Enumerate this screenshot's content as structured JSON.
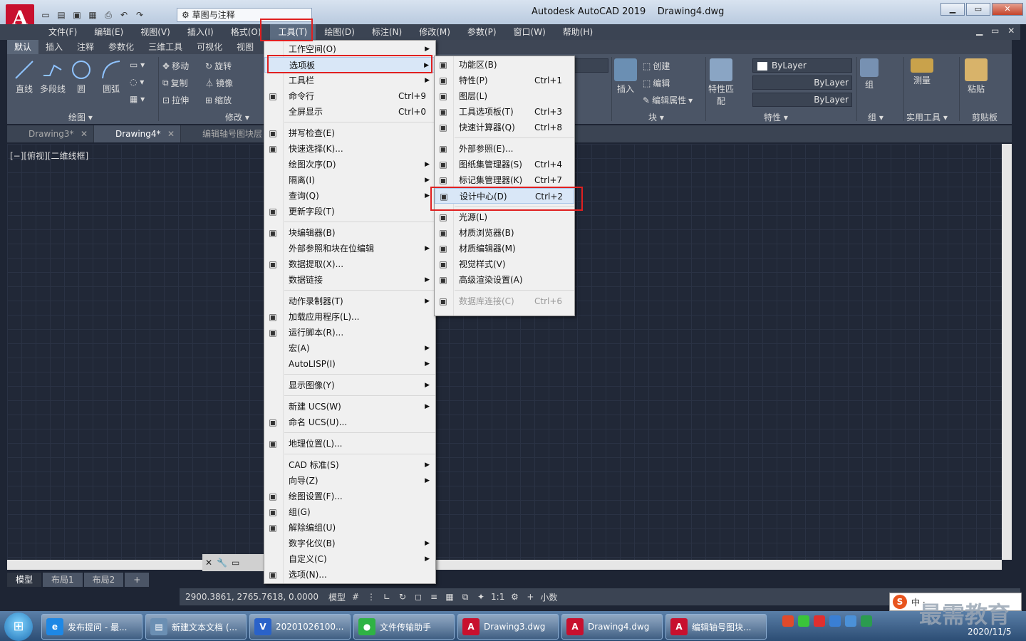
{
  "app": {
    "title": "Autodesk AutoCAD 2019",
    "filename": "Drawing4.dwg",
    "logo_letter": "A",
    "workspace": "草图与注释",
    "win_min": "▁",
    "win_restore": "▭",
    "win_close": "✕"
  },
  "menubar": [
    "文件(F)",
    "编辑(E)",
    "视图(V)",
    "插入(I)",
    "格式(O)",
    "工具(T)",
    "绘图(D)",
    "标注(N)",
    "修改(M)",
    "参数(P)",
    "窗口(W)",
    "帮助(H)"
  ],
  "menubar_active": 5,
  "ribbon_tabs": [
    "默认",
    "插入",
    "注释",
    "参数化",
    "三维工具",
    "可视化",
    "视图"
  ],
  "ribbon": {
    "draw_tools": [
      "直线",
      "多段线",
      "圆",
      "圆弧"
    ],
    "draw_panel": "绘图 ▾",
    "modify_tools": [
      "移动",
      "旋转",
      "复制",
      "镜像",
      "拉伸",
      "缩放"
    ],
    "modify_panel": "修改 ▾",
    "block_insert": "插入",
    "block_tools": [
      "创建",
      "编辑",
      "编辑属性"
    ],
    "block_panel": "块 ▾",
    "match_props": "特性匹配",
    "bylayer": [
      "ByLayer",
      "ByLayer",
      "ByLayer"
    ],
    "props_panel": "特性 ▾",
    "group": "组",
    "group_panel": "组 ▾",
    "measure": "测量",
    "utils_panel": "实用工具 ▾",
    "paste": "粘贴",
    "clipboard_panel": "剪贴板"
  },
  "doc_tabs": [
    "Drawing3*",
    "Drawing4*",
    "编辑轴号图块层"
  ],
  "view_label": "[−][俯视][二维线框]",
  "layout_tabs": [
    "模型",
    "布局1",
    "布局2",
    "+"
  ],
  "status": {
    "coords": "2900.3861, 2765.7618, 0.0000",
    "model": "模型",
    "scale": "1:1",
    "units": "小数"
  },
  "tools_menu": [
    {
      "label": "工作空间(O)",
      "arrow": true
    },
    {
      "label": "选项板",
      "arrow": true,
      "highlight": true
    },
    {
      "label": "工具栏",
      "arrow": true
    },
    {
      "label": "命令行",
      "shortcut": "Ctrl+9",
      "icon": "command-line-icon"
    },
    {
      "label": "全屏显示",
      "shortcut": "Ctrl+0"
    },
    {
      "sep": true
    },
    {
      "label": "拼写检查(E)",
      "icon": "spell-check-icon"
    },
    {
      "label": "快速选择(K)...",
      "icon": "quick-select-icon"
    },
    {
      "label": "绘图次序(D)",
      "arrow": true
    },
    {
      "label": "隔离(I)",
      "arrow": true
    },
    {
      "label": "查询(Q)",
      "arrow": true
    },
    {
      "label": "更新字段(T)",
      "icon": "update-field-icon"
    },
    {
      "sep": true
    },
    {
      "label": "块编辑器(B)",
      "icon": "block-editor-icon"
    },
    {
      "label": "外部参照和块在位编辑",
      "arrow": true
    },
    {
      "label": "数据提取(X)...",
      "icon": "data-extract-icon"
    },
    {
      "label": "数据链接",
      "arrow": true
    },
    {
      "sep": true
    },
    {
      "label": "动作录制器(T)",
      "arrow": true
    },
    {
      "label": "加载应用程序(L)...",
      "icon": "load-app-icon"
    },
    {
      "label": "运行脚本(R)...",
      "icon": "run-script-icon"
    },
    {
      "label": "宏(A)",
      "arrow": true
    },
    {
      "label": "AutoLISP(I)",
      "arrow": true
    },
    {
      "sep": true
    },
    {
      "label": "显示图像(Y)",
      "arrow": true
    },
    {
      "sep": true
    },
    {
      "label": "新建 UCS(W)",
      "arrow": true
    },
    {
      "label": "命名 UCS(U)...",
      "icon": "named-ucs-icon"
    },
    {
      "sep": true
    },
    {
      "label": "地理位置(L)...",
      "icon": "globe-icon"
    },
    {
      "sep": true
    },
    {
      "label": "CAD 标准(S)",
      "arrow": true
    },
    {
      "label": "向导(Z)",
      "arrow": true
    },
    {
      "label": "绘图设置(F)...",
      "icon": "drafting-settings-icon"
    },
    {
      "label": "组(G)",
      "icon": "group-icon"
    },
    {
      "label": "解除编组(U)",
      "icon": "ungroup-icon"
    },
    {
      "label": "数字化仪(B)",
      "arrow": true
    },
    {
      "label": "自定义(C)",
      "arrow": true
    },
    {
      "label": "选项(N)...",
      "icon": "options-check-icon"
    }
  ],
  "palettes_menu": [
    {
      "label": "功能区(B)",
      "icon": "ribbon-icon"
    },
    {
      "label": "特性(P)",
      "shortcut": "Ctrl+1",
      "icon": "properties-icon"
    },
    {
      "label": "图层(L)",
      "icon": "layers-icon"
    },
    {
      "label": "工具选项板(T)",
      "shortcut": "Ctrl+3",
      "icon": "tool-palettes-icon"
    },
    {
      "label": "快速计算器(Q)",
      "shortcut": "Ctrl+8",
      "icon": "calculator-icon"
    },
    {
      "sep": true
    },
    {
      "label": "外部参照(E)...",
      "icon": "xref-icon"
    },
    {
      "label": "图纸集管理器(S)",
      "shortcut": "Ctrl+4",
      "icon": "sheet-set-icon"
    },
    {
      "label": "标记集管理器(K)",
      "shortcut": "Ctrl+7",
      "icon": "markup-set-icon"
    },
    {
      "label": "设计中心(D)",
      "shortcut": "Ctrl+2",
      "icon": "design-center-icon",
      "highlight": true
    },
    {
      "sep": true
    },
    {
      "label": "光源(L)",
      "icon": "lights-icon"
    },
    {
      "label": "材质浏览器(B)",
      "icon": "materials-browser-icon"
    },
    {
      "label": "材质编辑器(M)",
      "icon": "materials-editor-icon"
    },
    {
      "label": "视觉样式(V)",
      "icon": "visual-styles-icon"
    },
    {
      "label": "高级渲染设置(A)",
      "icon": "render-settings-icon"
    },
    {
      "sep": true
    },
    {
      "label": "数据库连接(C)",
      "shortcut": "Ctrl+6",
      "icon": "db-connect-icon",
      "disabled": true
    }
  ],
  "taskbar": [
    {
      "label": "发布提问 - 最...",
      "color": "#1e88e5",
      "icon": "e"
    },
    {
      "label": "新建文本文档 (...",
      "color": "#6b8fb3",
      "icon": "▤"
    },
    {
      "label": "20201026100...",
      "color": "#2a62c9",
      "icon": "V"
    },
    {
      "label": "文件传输助手",
      "color": "#2fb344",
      "icon": "●"
    },
    {
      "label": "Drawing3.dwg",
      "color": "#c8102e",
      "icon": "A"
    },
    {
      "label": "Drawing4.dwg",
      "color": "#c8102e",
      "icon": "A"
    },
    {
      "label": "编辑轴号图块...",
      "color": "#c8102e",
      "icon": "A"
    }
  ],
  "clock": "2020/11/5",
  "watermark": "最需教育",
  "sogou": {
    "logo": "S",
    "text": "中 ·"
  }
}
